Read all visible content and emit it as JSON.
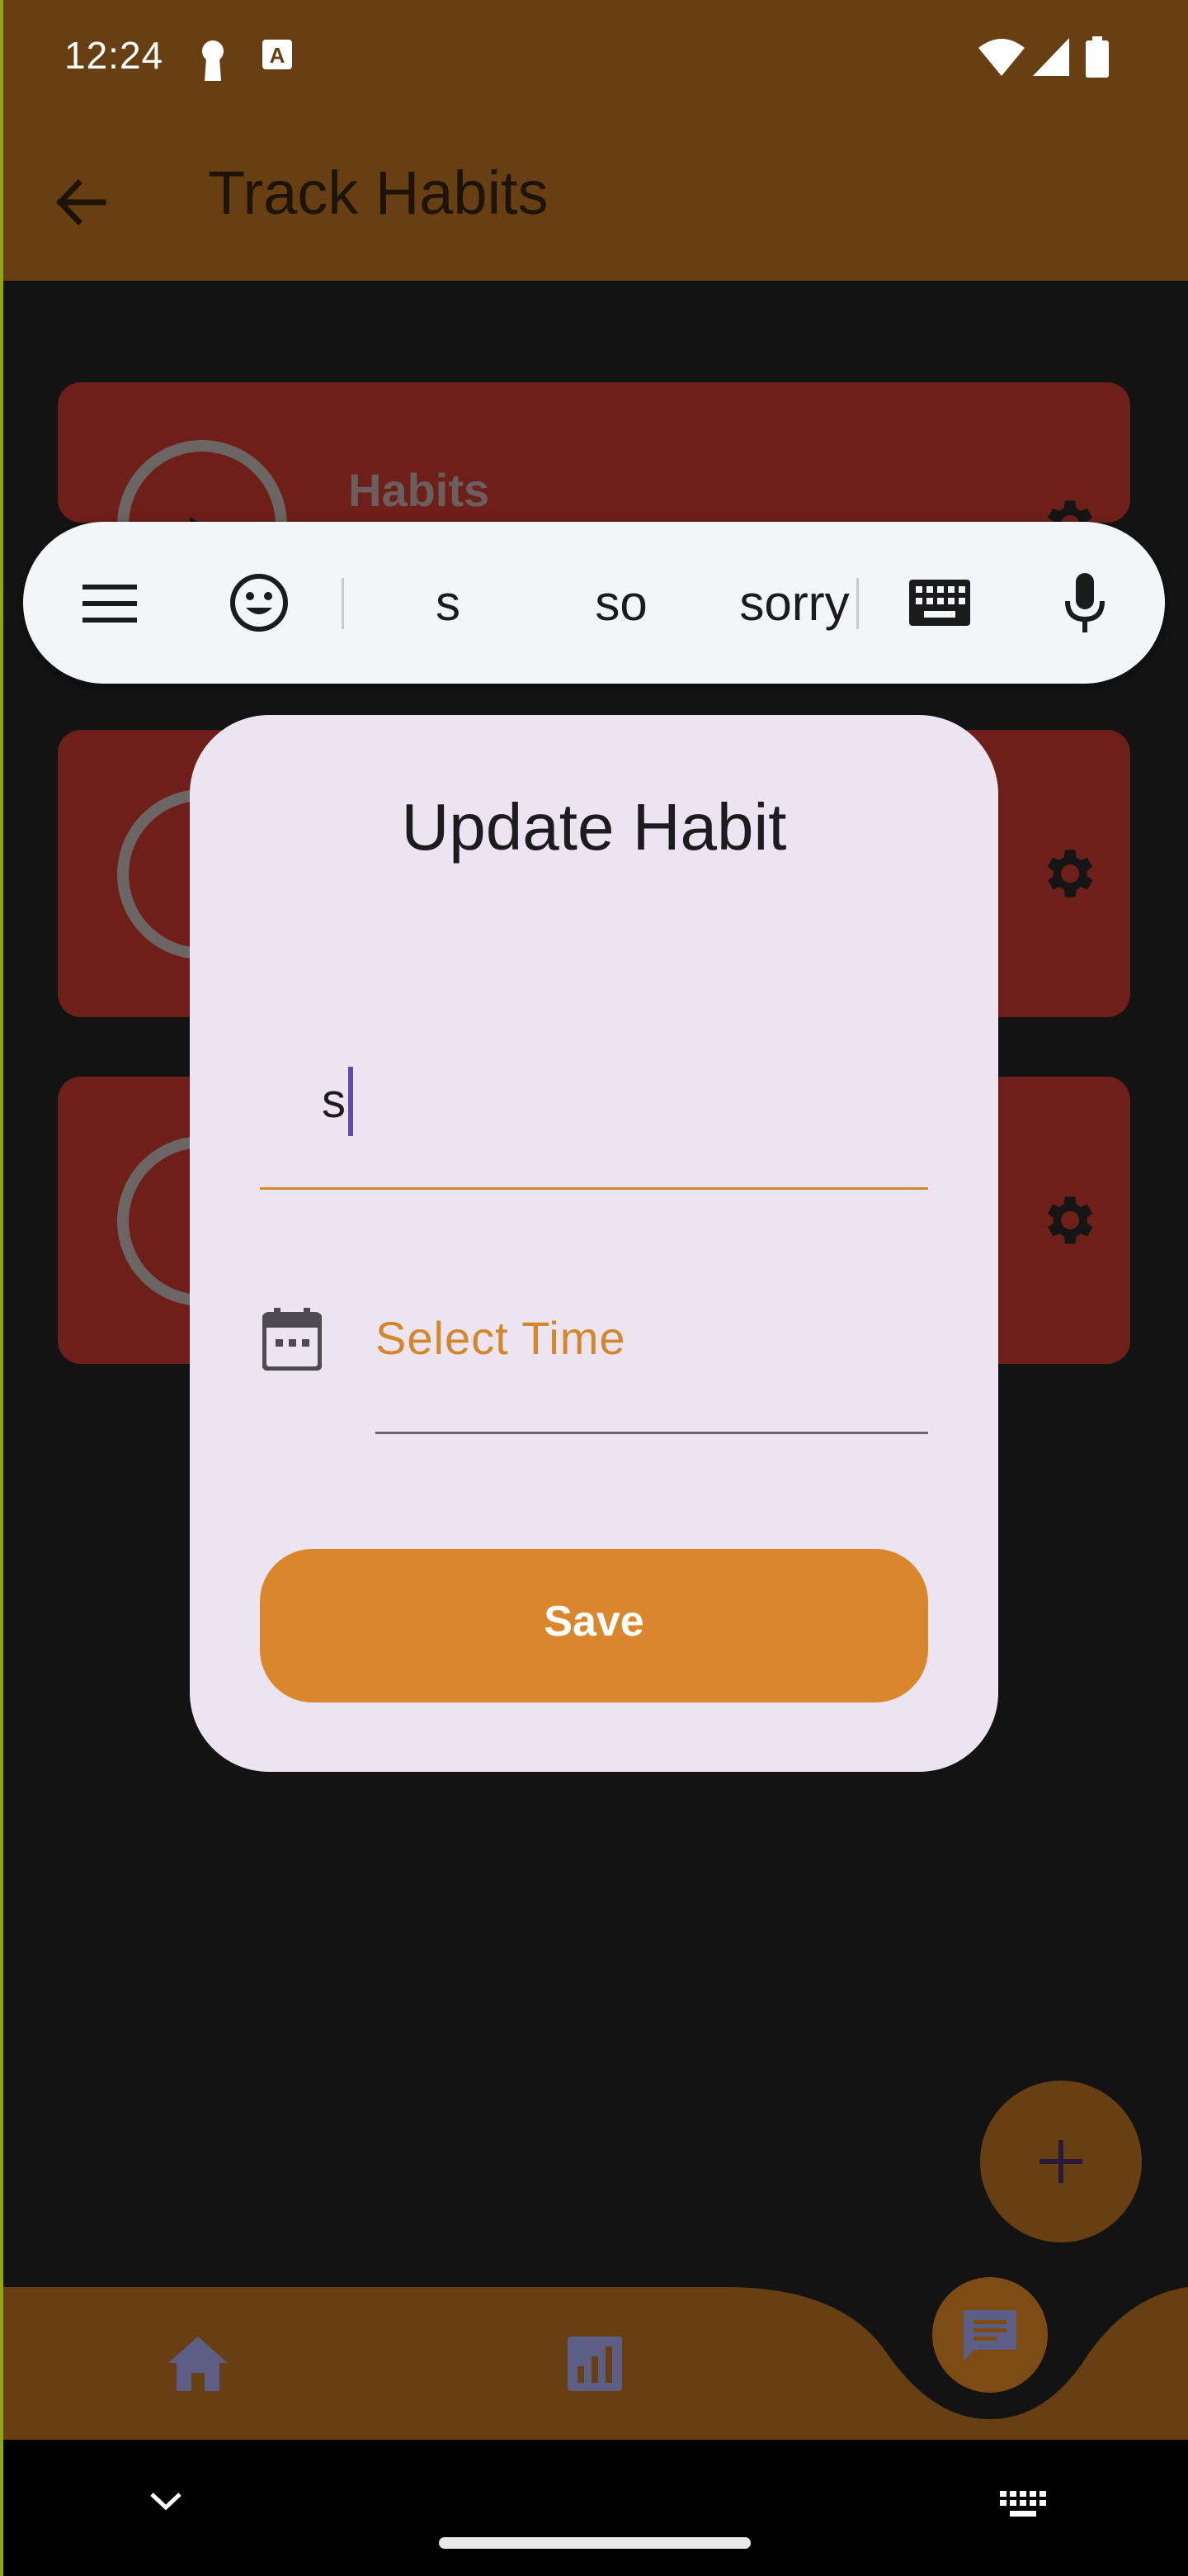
{
  "status_bar": {
    "time": "12:24",
    "icons": [
      "keyhole-icon",
      "translate-a-icon",
      "wifi-icon",
      "signal-icon",
      "battery-icon"
    ]
  },
  "app_bar": {
    "title": "Track Habits",
    "back_icon": "arrow-back-icon"
  },
  "habit_cards": [
    {
      "title": "Habits",
      "gear_icon": "gear-icon"
    },
    {
      "title": "",
      "gear_icon": "gear-icon"
    },
    {
      "title": "",
      "gear_icon": "gear-icon"
    }
  ],
  "keyboard_bar": {
    "menu_icon": "menu-icon",
    "emoji_icon": "emoji-icon",
    "suggestions": [
      "s",
      "so",
      "sorry"
    ],
    "keyboard_icon": "keyboard-icon",
    "mic_icon": "mic-icon"
  },
  "dialog": {
    "title": "Update Habit",
    "name_value": "s",
    "time_placeholder": "Select Time",
    "save_label": "Save"
  },
  "fab": {
    "icon": "plus-icon"
  },
  "bottom_nav": {
    "items": [
      "home-icon",
      "stats-icon",
      "chat-icon"
    ]
  },
  "colors": {
    "app_bar": "#673f13",
    "card": "#6f1f1a",
    "accent": "#da862d",
    "dialog_bg": "#ece5f1"
  }
}
